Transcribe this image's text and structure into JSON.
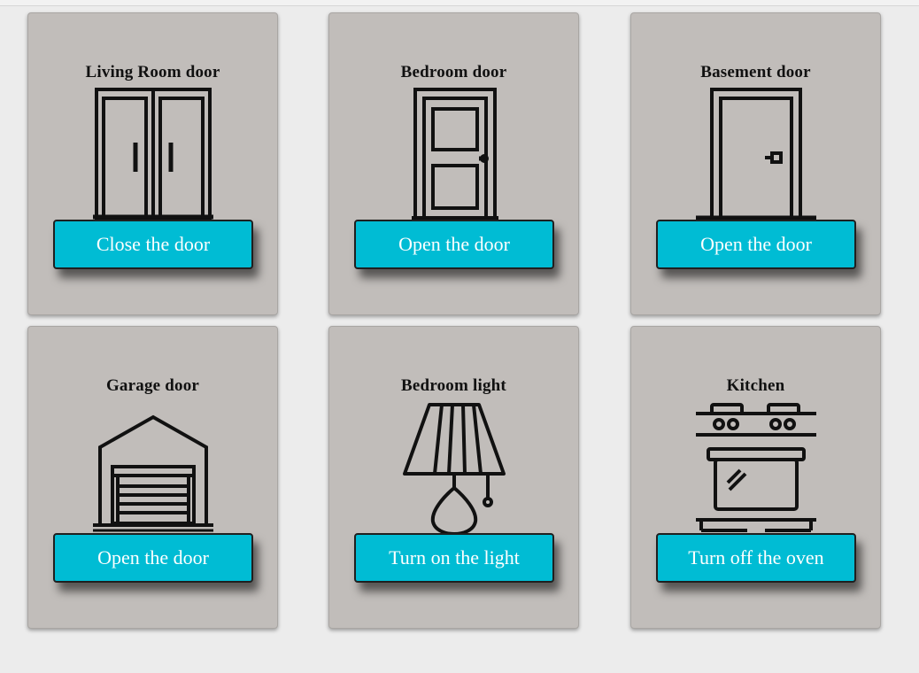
{
  "cards": [
    {
      "title": "Living Room door",
      "button_label": "Close the door",
      "icon": "double-door-icon"
    },
    {
      "title": "Bedroom door",
      "button_label": "Open the door",
      "icon": "panel-door-icon"
    },
    {
      "title": "Basement door",
      "button_label": "Open the door",
      "icon": "door-icon"
    },
    {
      "title": "Garage door",
      "button_label": "Open the door",
      "icon": "garage-icon"
    },
    {
      "title": "Bedroom light",
      "button_label": "Turn on the light",
      "icon": "lamp-icon"
    },
    {
      "title": "Kitchen",
      "button_label": "Turn off the oven",
      "icon": "oven-icon"
    }
  ],
  "colors": {
    "background": "#ececec",
    "card": "#c1bdba",
    "button": "#00bcd4",
    "button_text": "#ffffff"
  }
}
